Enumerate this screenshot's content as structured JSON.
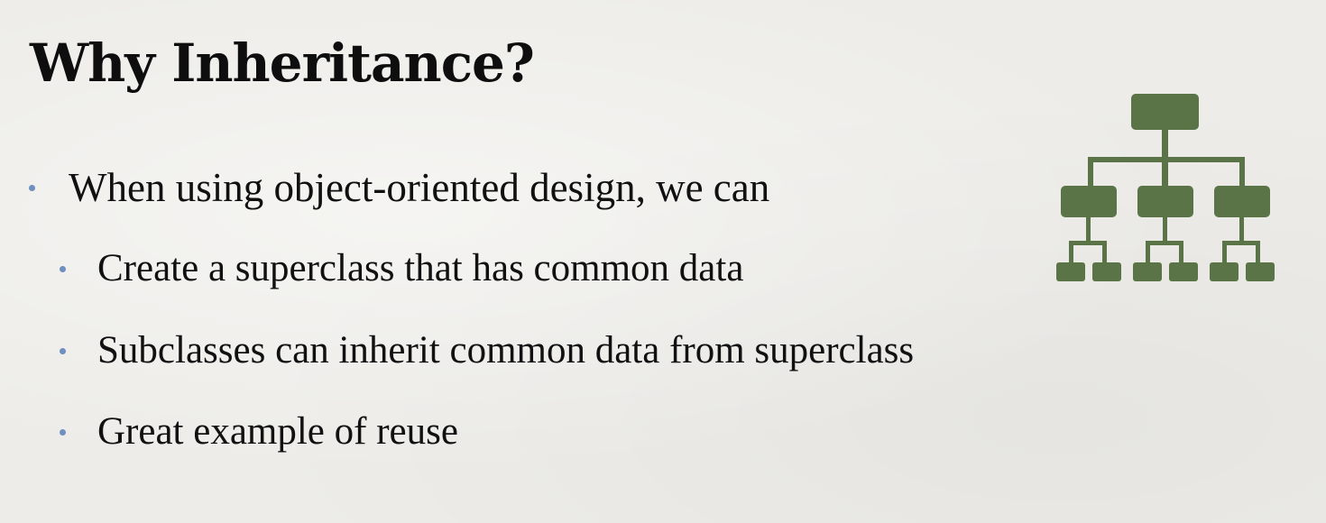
{
  "slide": {
    "title": "Why Inheritance?",
    "bullets": [
      {
        "level": 1,
        "text": "When using object-oriented design, we can"
      },
      {
        "level": 2,
        "text": "Create a superclass that has common data"
      },
      {
        "level": 2,
        "text": "Subclasses can inherit common data from superclass"
      },
      {
        "level": 2,
        "text": "Great example of reuse"
      }
    ],
    "icon": {
      "name": "hierarchy-tree-icon",
      "color": "#5a7347"
    },
    "colors": {
      "background": "#edece8",
      "title": "#0e0e0e",
      "text": "#111111",
      "bullet_dot": "#6e8fbf"
    }
  }
}
